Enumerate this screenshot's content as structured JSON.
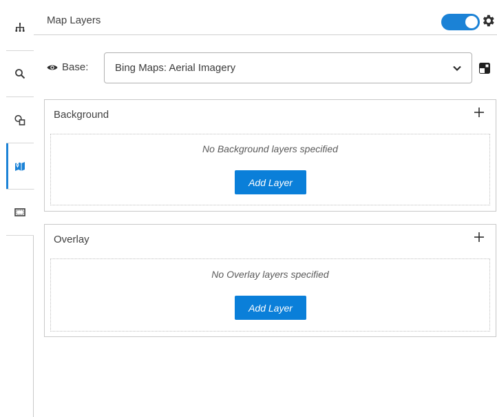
{
  "rail": {
    "tabs": [
      {
        "icon": "hierarchy-icon"
      },
      {
        "icon": "search-icon"
      },
      {
        "icon": "shapes-icon"
      },
      {
        "icon": "map-layers-icon",
        "active": true
      },
      {
        "icon": "frame-icon"
      }
    ]
  },
  "header": {
    "title": "Map Layers",
    "toggle_on": true
  },
  "base": {
    "label": "Base:",
    "selected": "Bing Maps: Aerial Imagery"
  },
  "background": {
    "title": "Background",
    "empty_text": "No Background layers specified",
    "add_label": "Add Layer"
  },
  "overlay": {
    "title": "Overlay",
    "empty_text": "No Overlay layers specified",
    "add_label": "Add Layer"
  },
  "colors": {
    "accent": "#1b82d6",
    "button": "#0a7fd9"
  }
}
